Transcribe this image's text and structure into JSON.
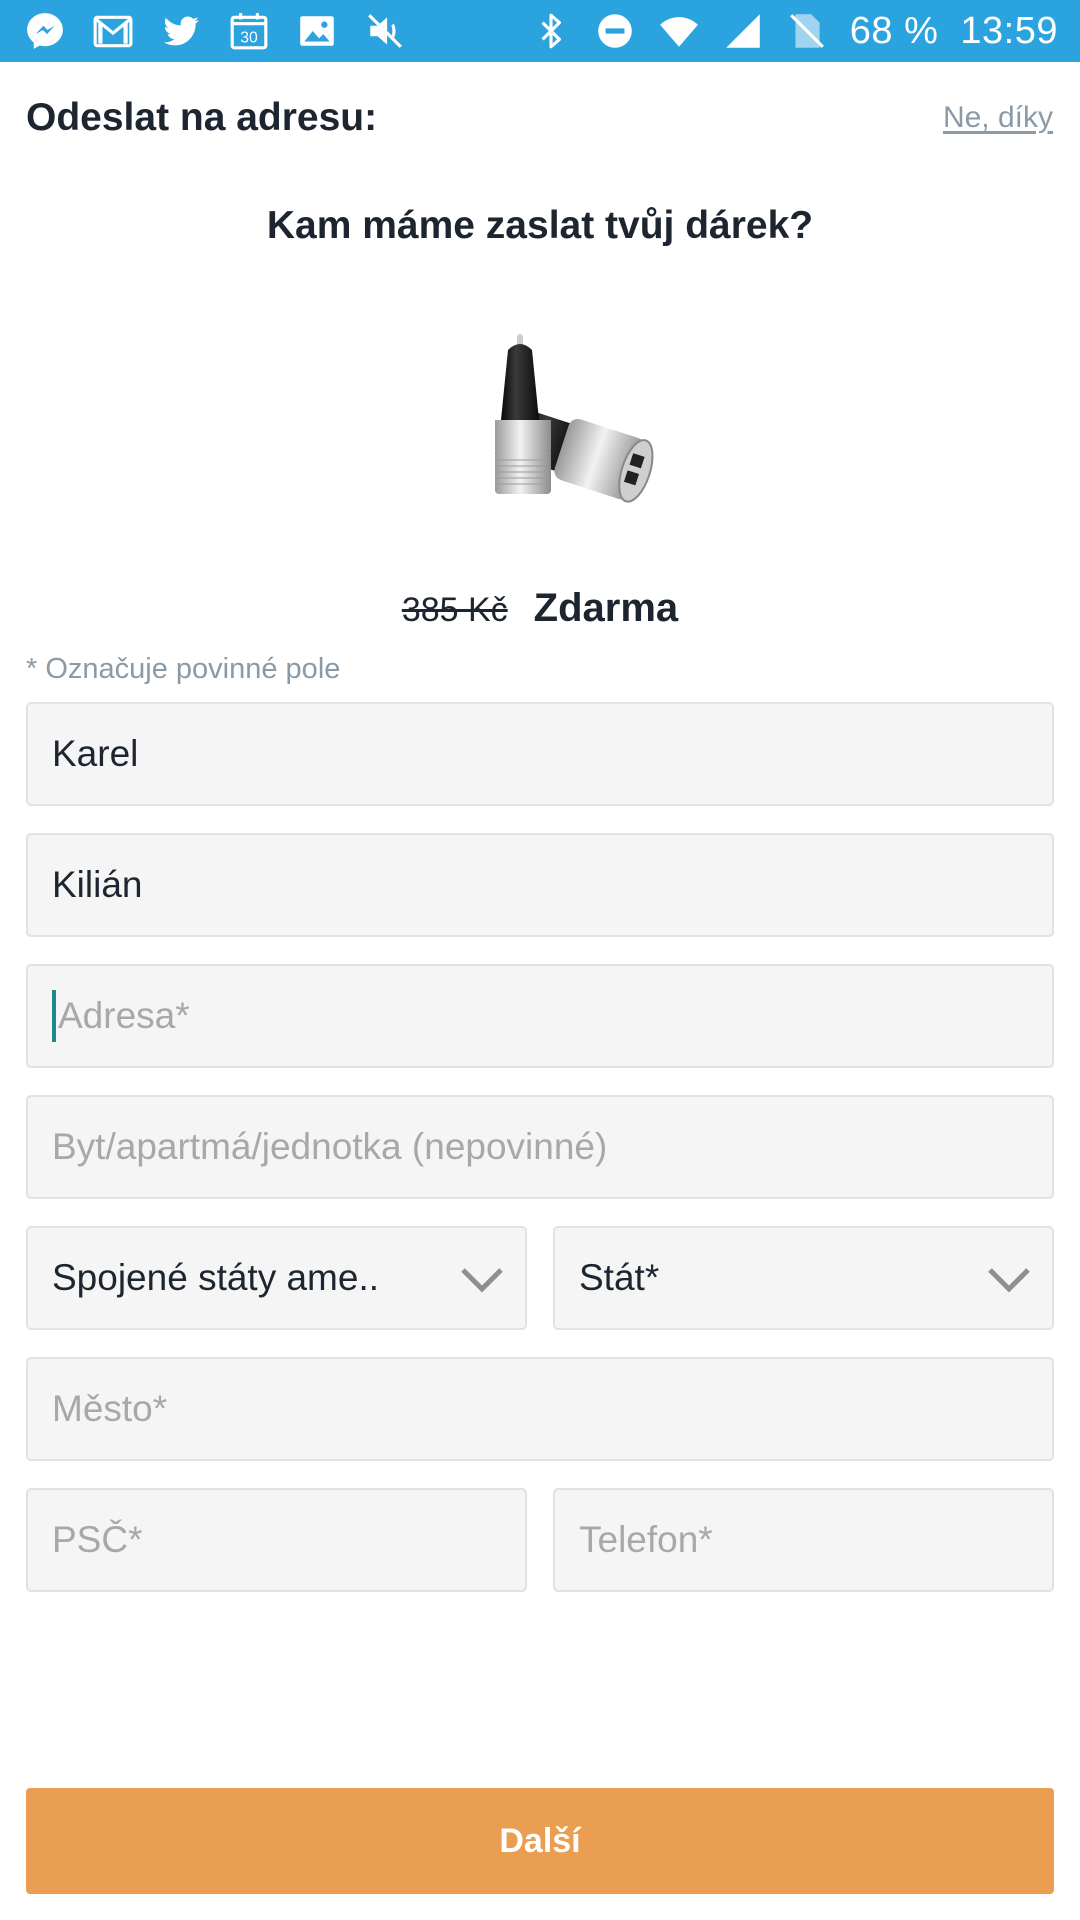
{
  "status_bar": {
    "battery_text": "68 %",
    "time": "13:59",
    "background_color": "#2aa3de",
    "icons_left": [
      "messenger-icon",
      "gmail-icon",
      "twitter-icon",
      "calendar-icon",
      "gallery-icon",
      "mute-icon"
    ],
    "calendar_day": "30",
    "icons_right": [
      "bluetooth-icon",
      "do-not-disturb-icon",
      "wifi-icon",
      "cell-signal-icon",
      "no-sim-icon"
    ]
  },
  "header": {
    "title": "Odeslat na adresu:",
    "dismiss_link": "Ne, díky"
  },
  "question": "Kam máme zaslat tvůj dárek?",
  "product": {
    "image": "car-charger-image",
    "old_price": "385 Kč",
    "new_price": "Zdarma"
  },
  "form": {
    "required_note": "* Označuje povinné pole",
    "first_name_value": "Karel",
    "last_name_value": "Kilián",
    "address_placeholder": "Adresa*",
    "apartment_placeholder": "Byt/apartmá/jednotka (nepovinné)",
    "country_value": "Spojené státy ame..",
    "state_value": "Stát*",
    "city_placeholder": "Město*",
    "zip_placeholder": "PSČ*",
    "phone_placeholder": "Telefon*"
  },
  "next_button": {
    "label": "Další",
    "color": "#ea9e52"
  }
}
